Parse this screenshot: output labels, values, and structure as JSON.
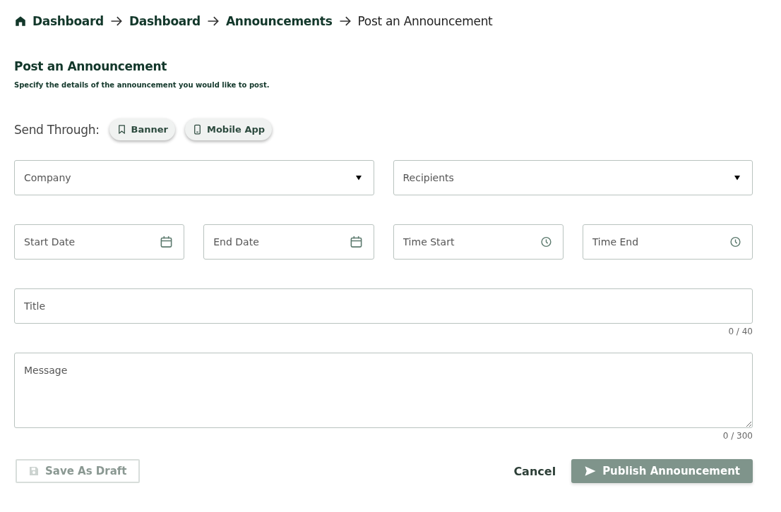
{
  "breadcrumb": [
    {
      "label": "Dashboard",
      "current": false,
      "home": true
    },
    {
      "label": "Dashboard",
      "current": false,
      "home": false
    },
    {
      "label": "Announcements",
      "current": false,
      "home": false
    },
    {
      "label": "Post an Announcement",
      "current": true,
      "home": false
    }
  ],
  "heading": "Post an Announcement",
  "subtitle": "Specify the details of the announcement you would like to post.",
  "send_through": {
    "label": "Send Through:",
    "options": [
      {
        "label": "Banner",
        "kind": "bookmark",
        "selected": false
      },
      {
        "label": "Mobile App",
        "kind": "phone",
        "selected": false
      }
    ]
  },
  "field_rows": [
    {
      "fields": [
        {
          "kind": "select",
          "placeholder": "Company"
        },
        {
          "kind": "select",
          "placeholder": "Recipients"
        }
      ]
    },
    {
      "fields": [
        {
          "kind": "date",
          "placeholder": "Start Date"
        },
        {
          "kind": "date",
          "placeholder": "End Date"
        },
        {
          "kind": "time",
          "placeholder": "Time Start"
        },
        {
          "kind": "time",
          "placeholder": "Time End"
        }
      ]
    },
    {
      "fields": [
        {
          "kind": "text",
          "placeholder": "Title",
          "counter": "0 / 40"
        }
      ]
    },
    {
      "fields": [
        {
          "kind": "textarea",
          "placeholder": "Message",
          "counter": "0 / 300"
        }
      ]
    }
  ],
  "actions": {
    "draft": {
      "label": "Save As Draft",
      "disabled": true
    },
    "cancel": {
      "label": "Cancel"
    },
    "publish": {
      "label": "Publish Announcement",
      "disabled": true
    }
  }
}
